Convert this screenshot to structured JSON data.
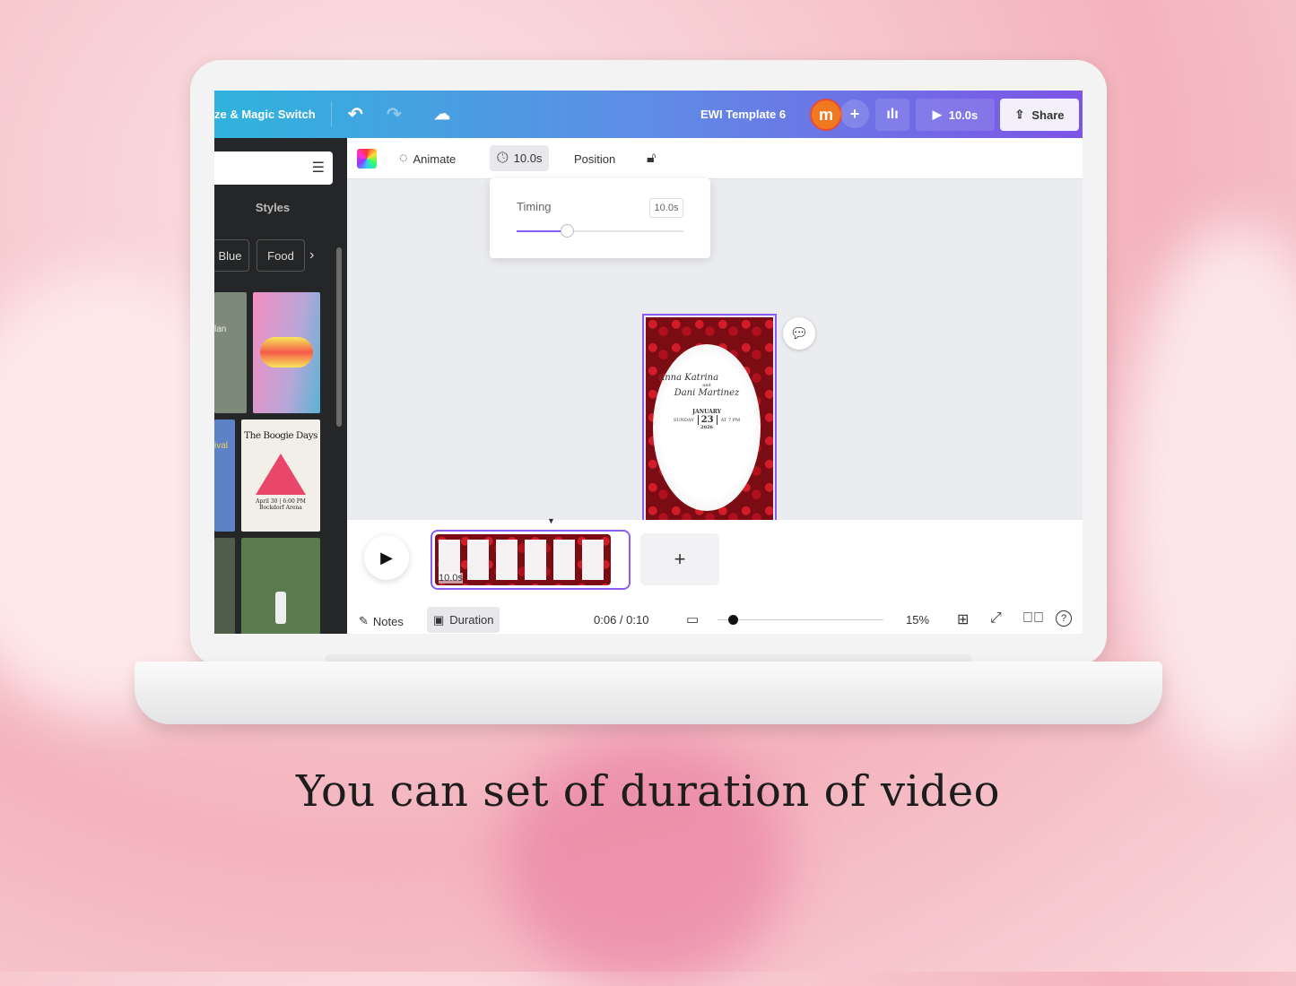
{
  "topbar": {
    "title_fragment": "ze & Magic Switch",
    "doc_title": "EWI Template 6",
    "avatar_letter": "m",
    "play_duration": "10.0s",
    "share": "Share"
  },
  "toolbar": {
    "animate": "Animate",
    "duration": "10.0s",
    "position": "Position"
  },
  "timing_popup": {
    "label": "Timing",
    "value": "10.0s",
    "slider_fraction": 0.3
  },
  "sidebar": {
    "styles": "Styles",
    "chips": [
      "Blue",
      "Food"
    ],
    "templates": [
      "lan",
      "The Boogie Days",
      "April 30 | 6:00 PM",
      "Bockdorf Arena",
      "ival"
    ]
  },
  "invitation": {
    "name1": "Anna Katrina",
    "and": "and",
    "name2": "Dani Martinez",
    "month": "JANUARY",
    "day": "SUNDAY",
    "date": "23",
    "time": "AT 7 PM",
    "year": "2026"
  },
  "timeline": {
    "clip_duration": "10.0s",
    "time": "0:06 / 0:10",
    "notes": "Notes",
    "duration": "Duration",
    "zoom": "15%"
  },
  "caption": "You can set of duration of video",
  "colors": {
    "accent": "#7d55e6",
    "avatar": "#f0781f"
  }
}
